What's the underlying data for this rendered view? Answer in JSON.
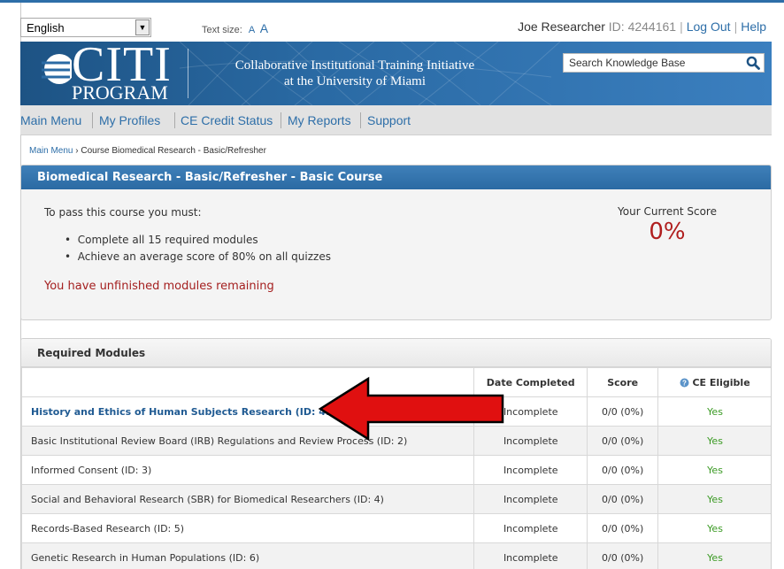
{
  "util": {
    "language": "English",
    "textsize_label": "Text size:",
    "textsize_small": "A",
    "textsize_large": "A",
    "user_name": "Joe Researcher",
    "user_id": "ID: 4244161",
    "logout": "Log Out",
    "help": "Help"
  },
  "banner": {
    "logo_citi": "CITI",
    "logo_program": "PROGRAM",
    "title_line1": "Collaborative Institutional Training Initiative",
    "title_line2": "at the University of Miami",
    "search_placeholder": "Search Knowledge Base"
  },
  "nav": {
    "items": [
      "Main Menu",
      "My Profiles",
      "CE Credit Status",
      "My Reports",
      "Support"
    ]
  },
  "breadcrumb": {
    "link": "Main Menu",
    "sep": "›",
    "current": "Course Biomedical Research - Basic/Refresher"
  },
  "course": {
    "title": "Biomedical Research - Basic/Refresher - Basic Course",
    "intro": "To pass this course you must:",
    "bullets": [
      "Complete all 15 required modules",
      "Achieve an average score of 80% on all quizzes"
    ],
    "warning": "You have unfinished modules remaining",
    "score_label": "Your Current Score",
    "score_value": "0%"
  },
  "modules": {
    "title": "Required Modules",
    "headers": [
      "",
      "Date Completed",
      "Score",
      "CE Eligible"
    ],
    "rows": [
      {
        "name": "History and Ethics of Human Subjects Research (ID: 498)",
        "date": "Incomplete",
        "score": "0/0 (0%)",
        "ce": "Yes"
      },
      {
        "name": "Basic Institutional Review Board (IRB) Regulations and Review Process (ID: 2)",
        "date": "Incomplete",
        "score": "0/0 (0%)",
        "ce": "Yes"
      },
      {
        "name": "Informed Consent (ID: 3)",
        "date": "Incomplete",
        "score": "0/0 (0%)",
        "ce": "Yes"
      },
      {
        "name": "Social and Behavioral Research (SBR) for Biomedical Researchers (ID: 4)",
        "date": "Incomplete",
        "score": "0/0 (0%)",
        "ce": "Yes"
      },
      {
        "name": "Records-Based Research (ID: 5)",
        "date": "Incomplete",
        "score": "0/0 (0%)",
        "ce": "Yes"
      },
      {
        "name": "Genetic Research in Human Populations (ID: 6)",
        "date": "Incomplete",
        "score": "0/0 (0%)",
        "ce": "Yes"
      }
    ]
  },
  "colors": {
    "brand_blue": "#2d6ea8",
    "warning_red": "#b01e1e",
    "yes_green": "#3a9a23",
    "arrow_red": "#e01010"
  }
}
